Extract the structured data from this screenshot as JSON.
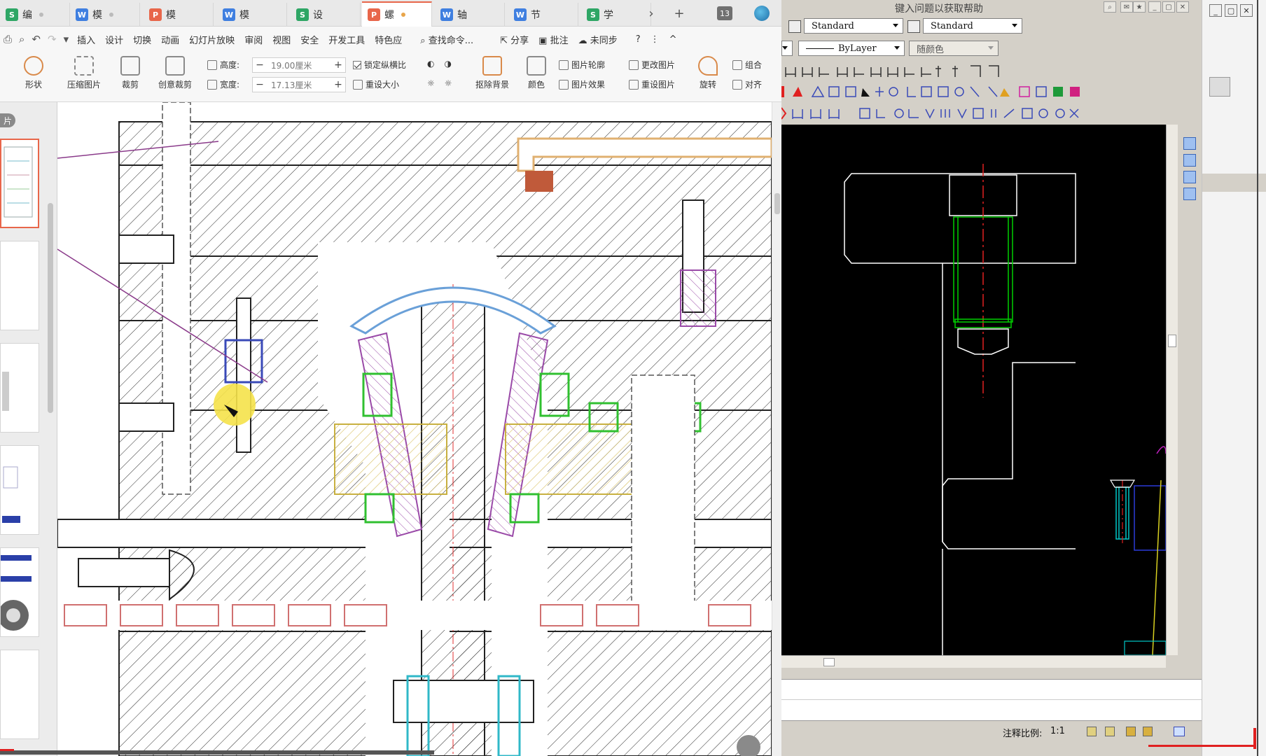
{
  "wps": {
    "tabs": [
      {
        "type": "s",
        "glyph": "S",
        "label": "编",
        "dot": "grey"
      },
      {
        "type": "w",
        "glyph": "W",
        "label": "模",
        "dot": "grey"
      },
      {
        "type": "p",
        "glyph": "P",
        "label": "模",
        "dot": "none"
      },
      {
        "type": "w",
        "glyph": "W",
        "label": "模",
        "dot": "none"
      },
      {
        "type": "s",
        "glyph": "S",
        "label": "设",
        "dot": "none"
      },
      {
        "type": "p",
        "glyph": "P",
        "label": "螺",
        "dot": "orange",
        "active": true
      },
      {
        "type": "w",
        "glyph": "W",
        "label": "轴",
        "dot": "none"
      },
      {
        "type": "w",
        "glyph": "W",
        "label": "节",
        "dot": "none"
      },
      {
        "type": "s",
        "glyph": "S",
        "label": "学",
        "dot": "none"
      }
    ],
    "tab_more": "›",
    "tab_add": "+",
    "tab_count": "13",
    "menu": {
      "qat_icons": [
        "print-icon",
        "preview-icon",
        "undo-icon",
        "redo-icon",
        "customize-icon"
      ],
      "items": [
        "插入",
        "设计",
        "切换",
        "动画",
        "幻灯片放映",
        "审阅",
        "视图",
        "安全",
        "开发工具",
        "特色应"
      ],
      "search": "查找命令...",
      "share": "分享",
      "comment": "批注",
      "sync": "未同步",
      "help": "?",
      "more": "⋮",
      "collapse": "^"
    },
    "ribbon": {
      "shape": "形状",
      "compress": "压缩图片",
      "crop": "裁剪",
      "creative_crop": "创意裁剪",
      "height_label": "高度:",
      "height_value": "19.00厘米",
      "width_label": "宽度:",
      "width_value": "17.13厘米",
      "lock_ratio": "锁定纵横比",
      "reset_size": "重设大小",
      "remove_bg": "抠除背景",
      "color": "颜色",
      "outline": "图片轮廓",
      "effect": "图片效果",
      "change_pic": "更改图片",
      "reset_pic": "重设图片",
      "rotate": "旋转",
      "group": "组合",
      "align": "对齐"
    },
    "panel_tab": "片"
  },
  "cad": {
    "help_text": "键入问题以获取帮助",
    "text_style": "Standard",
    "dim_style": "Standard",
    "linetype": "ByLayer",
    "color": "随颜色",
    "annotation_scale_label": "注释比例:",
    "annotation_scale_value": "1:1"
  },
  "colors": {
    "wps_accent": "#e8664a",
    "word_blue": "#3f7fe0",
    "excel_green": "#2ea665",
    "cad_bg": "#000000",
    "cad_cyan": "#00c8c8",
    "cad_green": "#00d000",
    "cad_red": "#e02020"
  }
}
